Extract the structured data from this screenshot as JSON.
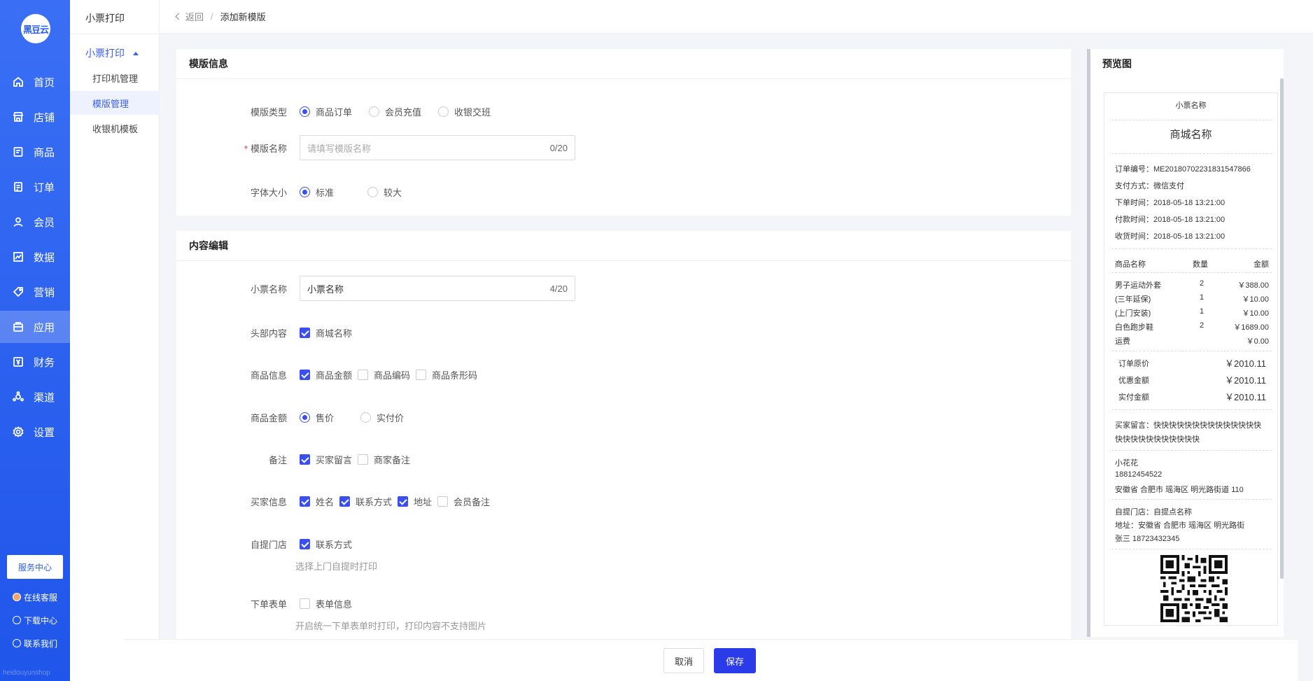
{
  "brand": {
    "logo_text": "黑豆云",
    "watermark": "heidouyunshop"
  },
  "main_nav": [
    {
      "label": "首页",
      "icon": "home-icon"
    },
    {
      "label": "店铺",
      "icon": "store-icon"
    },
    {
      "label": "商品",
      "icon": "goods-icon"
    },
    {
      "label": "订单",
      "icon": "order-icon"
    },
    {
      "label": "会员",
      "icon": "member-icon"
    },
    {
      "label": "数据",
      "icon": "data-icon"
    },
    {
      "label": "营销",
      "icon": "marketing-icon"
    },
    {
      "label": "应用",
      "icon": "app-icon",
      "active": true
    },
    {
      "label": "财务",
      "icon": "finance-icon"
    },
    {
      "label": "渠道",
      "icon": "channel-icon"
    },
    {
      "label": "设置",
      "icon": "settings-icon"
    }
  ],
  "sidebar_bottom": {
    "service_center": "服务中心",
    "online_service": "在线客服",
    "download_center": "下载中心",
    "contact_us": "联系我们"
  },
  "sub_nav": {
    "title": "小票打印",
    "group": "小票打印",
    "items": [
      {
        "label": "打印机管理"
      },
      {
        "label": "模版管理",
        "active": true
      },
      {
        "label": "收银机模板"
      }
    ]
  },
  "breadcrumb": {
    "back": "返回",
    "separator": "/",
    "current": "添加新模版"
  },
  "template_info": {
    "title": "模版信息",
    "type_label": "模版类型",
    "type_options": [
      "商品订单",
      "会员充值",
      "收银交班"
    ],
    "name_label": "模版名称",
    "name_placeholder": "请填写模版名称",
    "name_count": "0/20",
    "font_label": "字体大小",
    "font_options": [
      "标准",
      "较大"
    ]
  },
  "content_edit": {
    "title": "内容编辑",
    "ticket_name_label": "小票名称",
    "ticket_name_value": "小票名称",
    "ticket_name_count": "4/20",
    "header_label": "头部内容",
    "header_options": [
      "商城名称"
    ],
    "goods_info_label": "商品信息",
    "goods_info_options": [
      "商品金额",
      "商品编码",
      "商品条形码"
    ],
    "goods_amount_label": "商品金额",
    "goods_amount_options": [
      "售价",
      "实付价"
    ],
    "remark_label": "备注",
    "remark_options": [
      "买家留言",
      "商家备注"
    ],
    "buyer_label": "买家信息",
    "buyer_options": [
      "姓名",
      "联系方式",
      "地址",
      "会员备注"
    ],
    "pickup_label": "自提门店",
    "pickup_options": [
      "联系方式"
    ],
    "pickup_hint": "选择上门自提时打印",
    "order_form_label": "下单表单",
    "order_form_options": [
      "表单信息"
    ],
    "order_form_hint": "开启统一下单表单时打印，打印内容不支持图片"
  },
  "preview": {
    "title": "预览图",
    "receipt": {
      "ticket_name": "小票名称",
      "mall_name": "商城名称",
      "order_no": "订单编号：ME20180702231831547866",
      "pay_method": "支付方式：微信支付",
      "order_time": "下单时间：2018-05-18 13:21:00",
      "pay_time": "付款时间：2018-05-18 13:21:00",
      "receive_time": "收货时间：2018-05-18 13:21:00",
      "col_name": "商品名称",
      "col_qty": "数量",
      "col_amount": "金额",
      "items": [
        {
          "name": "男子运动外套",
          "qty": "2",
          "amount": "￥388.00"
        },
        {
          "name": "(三年延保)",
          "qty": "1",
          "amount": "￥10.00"
        },
        {
          "name": "(上门安装)",
          "qty": "1",
          "amount": "￥10.00"
        },
        {
          "name": "白色跑步鞋",
          "qty": "2",
          "amount": "￥1689.00"
        },
        {
          "name": "运费",
          "qty": "",
          "amount": "￥0.00"
        }
      ],
      "totals": [
        {
          "label": "订单原价",
          "value": "￥2010.11"
        },
        {
          "label": "优惠金额",
          "value": "￥2010.11"
        },
        {
          "label": "实付金额",
          "value": "￥2010.11"
        }
      ],
      "buyer_message_1": "买家留言：快快快快快快快快快快快快快快",
      "buyer_message_2": "快快快快快快快快快快快",
      "buyer_name": "小花花",
      "buyer_phone": "18812454522",
      "buyer_address": "安徽省 合肥市 瑶海区 明光路街道 110",
      "pickup_store": "自提门店：自提点名称",
      "pickup_address": "地址：安徽省 合肥市 瑶海区 明光路街",
      "pickup_contact": "张三 18723432345"
    }
  },
  "footer": {
    "cancel": "取消",
    "save": "保存"
  },
  "colors": {
    "primary": "#2b3be8",
    "sidebar": "#2a5ef0"
  }
}
